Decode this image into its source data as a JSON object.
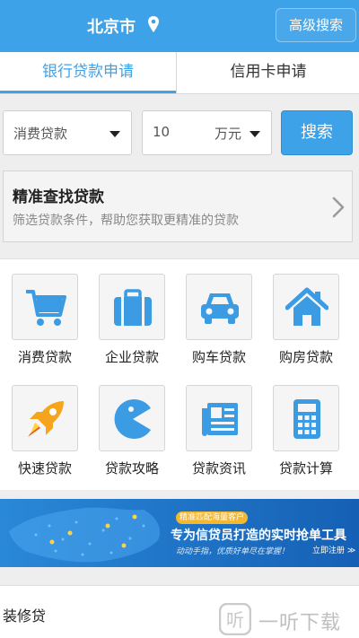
{
  "header": {
    "city": "北京市",
    "advanced_search": "高级搜索"
  },
  "tabs": [
    {
      "label": "银行贷款申请",
      "active": true
    },
    {
      "label": "信用卡申请",
      "active": false
    }
  ],
  "search": {
    "loan_type": "消费贷款",
    "amount": "10",
    "amount_unit": "万元",
    "button": "搜索"
  },
  "finder": {
    "title": "精准查找贷款",
    "description": "筛选贷款条件，帮助您获取更精准的贷款"
  },
  "categories": [
    {
      "label": "消费贷款",
      "icon": "shopping-cart-icon"
    },
    {
      "label": "企业贷款",
      "icon": "briefcase-icon"
    },
    {
      "label": "购车贷款",
      "icon": "car-icon"
    },
    {
      "label": "购房贷款",
      "icon": "house-icon"
    },
    {
      "label": "快速贷款",
      "icon": "rocket-icon"
    },
    {
      "label": "贷款攻略",
      "icon": "pacman-icon"
    },
    {
      "label": "贷款资讯",
      "icon": "newspaper-icon"
    },
    {
      "label": "贷款计算",
      "icon": "calculator-icon"
    }
  ],
  "banner": {
    "tag": "精准匹配海量客户",
    "headline": "专为信贷员打造的实时抢单工具",
    "sub": "动动手指，优质好单尽在掌握！",
    "cta": "立即注册 ≫"
  },
  "list": {
    "first_item": "装修贷"
  },
  "watermark": {
    "text": "一听下载"
  },
  "colors": {
    "accent": "#3ea2e8",
    "icon_blue": "#3b9be3",
    "rocket_orange": "#f7a41d"
  }
}
